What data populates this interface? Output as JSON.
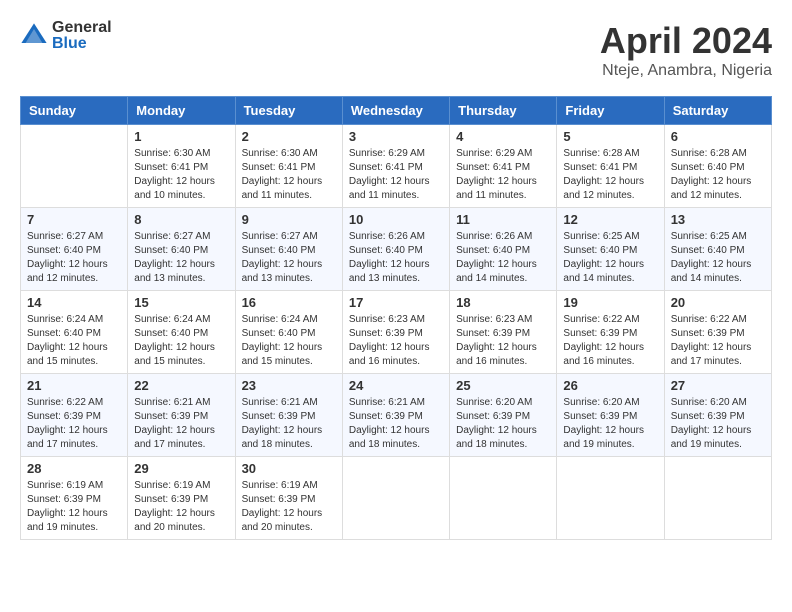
{
  "header": {
    "logo": {
      "general": "General",
      "blue": "Blue"
    },
    "title": "April 2024",
    "subtitle": "Nteje, Anambra, Nigeria"
  },
  "calendar": {
    "headers": [
      "Sunday",
      "Monday",
      "Tuesday",
      "Wednesday",
      "Thursday",
      "Friday",
      "Saturday"
    ],
    "weeks": [
      [
        {
          "day": "",
          "sunrise": "",
          "sunset": "",
          "daylight": ""
        },
        {
          "day": "1",
          "sunrise": "Sunrise: 6:30 AM",
          "sunset": "Sunset: 6:41 PM",
          "daylight": "Daylight: 12 hours and 10 minutes."
        },
        {
          "day": "2",
          "sunrise": "Sunrise: 6:30 AM",
          "sunset": "Sunset: 6:41 PM",
          "daylight": "Daylight: 12 hours and 11 minutes."
        },
        {
          "day": "3",
          "sunrise": "Sunrise: 6:29 AM",
          "sunset": "Sunset: 6:41 PM",
          "daylight": "Daylight: 12 hours and 11 minutes."
        },
        {
          "day": "4",
          "sunrise": "Sunrise: 6:29 AM",
          "sunset": "Sunset: 6:41 PM",
          "daylight": "Daylight: 12 hours and 11 minutes."
        },
        {
          "day": "5",
          "sunrise": "Sunrise: 6:28 AM",
          "sunset": "Sunset: 6:41 PM",
          "daylight": "Daylight: 12 hours and 12 minutes."
        },
        {
          "day": "6",
          "sunrise": "Sunrise: 6:28 AM",
          "sunset": "Sunset: 6:40 PM",
          "daylight": "Daylight: 12 hours and 12 minutes."
        }
      ],
      [
        {
          "day": "7",
          "sunrise": "Sunrise: 6:27 AM",
          "sunset": "Sunset: 6:40 PM",
          "daylight": "Daylight: 12 hours and 12 minutes."
        },
        {
          "day": "8",
          "sunrise": "Sunrise: 6:27 AM",
          "sunset": "Sunset: 6:40 PM",
          "daylight": "Daylight: 12 hours and 13 minutes."
        },
        {
          "day": "9",
          "sunrise": "Sunrise: 6:27 AM",
          "sunset": "Sunset: 6:40 PM",
          "daylight": "Daylight: 12 hours and 13 minutes."
        },
        {
          "day": "10",
          "sunrise": "Sunrise: 6:26 AM",
          "sunset": "Sunset: 6:40 PM",
          "daylight": "Daylight: 12 hours and 13 minutes."
        },
        {
          "day": "11",
          "sunrise": "Sunrise: 6:26 AM",
          "sunset": "Sunset: 6:40 PM",
          "daylight": "Daylight: 12 hours and 14 minutes."
        },
        {
          "day": "12",
          "sunrise": "Sunrise: 6:25 AM",
          "sunset": "Sunset: 6:40 PM",
          "daylight": "Daylight: 12 hours and 14 minutes."
        },
        {
          "day": "13",
          "sunrise": "Sunrise: 6:25 AM",
          "sunset": "Sunset: 6:40 PM",
          "daylight": "Daylight: 12 hours and 14 minutes."
        }
      ],
      [
        {
          "day": "14",
          "sunrise": "Sunrise: 6:24 AM",
          "sunset": "Sunset: 6:40 PM",
          "daylight": "Daylight: 12 hours and 15 minutes."
        },
        {
          "day": "15",
          "sunrise": "Sunrise: 6:24 AM",
          "sunset": "Sunset: 6:40 PM",
          "daylight": "Daylight: 12 hours and 15 minutes."
        },
        {
          "day": "16",
          "sunrise": "Sunrise: 6:24 AM",
          "sunset": "Sunset: 6:40 PM",
          "daylight": "Daylight: 12 hours and 15 minutes."
        },
        {
          "day": "17",
          "sunrise": "Sunrise: 6:23 AM",
          "sunset": "Sunset: 6:39 PM",
          "daylight": "Daylight: 12 hours and 16 minutes."
        },
        {
          "day": "18",
          "sunrise": "Sunrise: 6:23 AM",
          "sunset": "Sunset: 6:39 PM",
          "daylight": "Daylight: 12 hours and 16 minutes."
        },
        {
          "day": "19",
          "sunrise": "Sunrise: 6:22 AM",
          "sunset": "Sunset: 6:39 PM",
          "daylight": "Daylight: 12 hours and 16 minutes."
        },
        {
          "day": "20",
          "sunrise": "Sunrise: 6:22 AM",
          "sunset": "Sunset: 6:39 PM",
          "daylight": "Daylight: 12 hours and 17 minutes."
        }
      ],
      [
        {
          "day": "21",
          "sunrise": "Sunrise: 6:22 AM",
          "sunset": "Sunset: 6:39 PM",
          "daylight": "Daylight: 12 hours and 17 minutes."
        },
        {
          "day": "22",
          "sunrise": "Sunrise: 6:21 AM",
          "sunset": "Sunset: 6:39 PM",
          "daylight": "Daylight: 12 hours and 17 minutes."
        },
        {
          "day": "23",
          "sunrise": "Sunrise: 6:21 AM",
          "sunset": "Sunset: 6:39 PM",
          "daylight": "Daylight: 12 hours and 18 minutes."
        },
        {
          "day": "24",
          "sunrise": "Sunrise: 6:21 AM",
          "sunset": "Sunset: 6:39 PM",
          "daylight": "Daylight: 12 hours and 18 minutes."
        },
        {
          "day": "25",
          "sunrise": "Sunrise: 6:20 AM",
          "sunset": "Sunset: 6:39 PM",
          "daylight": "Daylight: 12 hours and 18 minutes."
        },
        {
          "day": "26",
          "sunrise": "Sunrise: 6:20 AM",
          "sunset": "Sunset: 6:39 PM",
          "daylight": "Daylight: 12 hours and 19 minutes."
        },
        {
          "day": "27",
          "sunrise": "Sunrise: 6:20 AM",
          "sunset": "Sunset: 6:39 PM",
          "daylight": "Daylight: 12 hours and 19 minutes."
        }
      ],
      [
        {
          "day": "28",
          "sunrise": "Sunrise: 6:19 AM",
          "sunset": "Sunset: 6:39 PM",
          "daylight": "Daylight: 12 hours and 19 minutes."
        },
        {
          "day": "29",
          "sunrise": "Sunrise: 6:19 AM",
          "sunset": "Sunset: 6:39 PM",
          "daylight": "Daylight: 12 hours and 20 minutes."
        },
        {
          "day": "30",
          "sunrise": "Sunrise: 6:19 AM",
          "sunset": "Sunset: 6:39 PM",
          "daylight": "Daylight: 12 hours and 20 minutes."
        },
        {
          "day": "",
          "sunrise": "",
          "sunset": "",
          "daylight": ""
        },
        {
          "day": "",
          "sunrise": "",
          "sunset": "",
          "daylight": ""
        },
        {
          "day": "",
          "sunrise": "",
          "sunset": "",
          "daylight": ""
        },
        {
          "day": "",
          "sunrise": "",
          "sunset": "",
          "daylight": ""
        }
      ]
    ]
  }
}
